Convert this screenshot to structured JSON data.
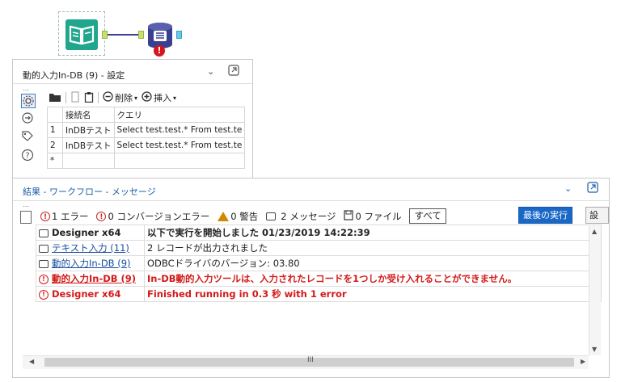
{
  "canvas": {
    "input_tool_icon": "book-icon",
    "db_tool_icon": "database-icon",
    "error_badge": "!"
  },
  "config_panel": {
    "title": "動的入力In-DB (9) - 設定",
    "toolbar": {
      "delete_label": "削除",
      "insert_label": "挿入"
    },
    "table": {
      "headers": [
        "接続名",
        "クエリ"
      ],
      "rows": [
        {
          "num": "1",
          "conn": "InDBテスト",
          "query": "Select test.test.* From test.te"
        },
        {
          "num": "2",
          "conn": "InDBテスト",
          "query": "Select test.test.* From test.te"
        },
        {
          "num": "*",
          "conn": "",
          "query": ""
        }
      ]
    }
  },
  "results_panel": {
    "title": "結果 - ワークフロー - メッセージ",
    "filters": {
      "errors": "1 エラー",
      "conv_errors": "0 コンバージョンエラー",
      "warnings": "0 警告",
      "messages": "2 メッセージ",
      "files": "0 ファイル",
      "all": "すべて"
    },
    "last_run_label": "最後の実行",
    "settings_label": "設定",
    "messages": [
      {
        "type": "message",
        "source": "Designer x64",
        "source_link": false,
        "text": "以下で実行を開始しました 01/23/2019 14:22:39",
        "bold": true
      },
      {
        "type": "message",
        "source": "テキスト入力 (11)",
        "source_link": true,
        "text": "2 レコードが出力されました",
        "bold": false
      },
      {
        "type": "message",
        "source": "動的入力In-DB (9)",
        "source_link": true,
        "text": "ODBCドライバのバージョン: 03.80",
        "bold": false
      },
      {
        "type": "error",
        "source": "動的入力In-DB (9)",
        "source_link": true,
        "text": "In-DB動的入力ツールは、入力されたレコードを1つしか受け入れることができません。",
        "bold": true
      },
      {
        "type": "error",
        "source": "Designer x64",
        "source_link": false,
        "text": "Finished running in 0.3 秒 with 1 error",
        "bold": true
      }
    ],
    "hscroll_grip": "III"
  },
  "colors": {
    "accent_blue": "#1967c7",
    "error_red": "#d41a1a",
    "tool_green": "#1fa68d",
    "db_navy": "#3b3f8f"
  }
}
